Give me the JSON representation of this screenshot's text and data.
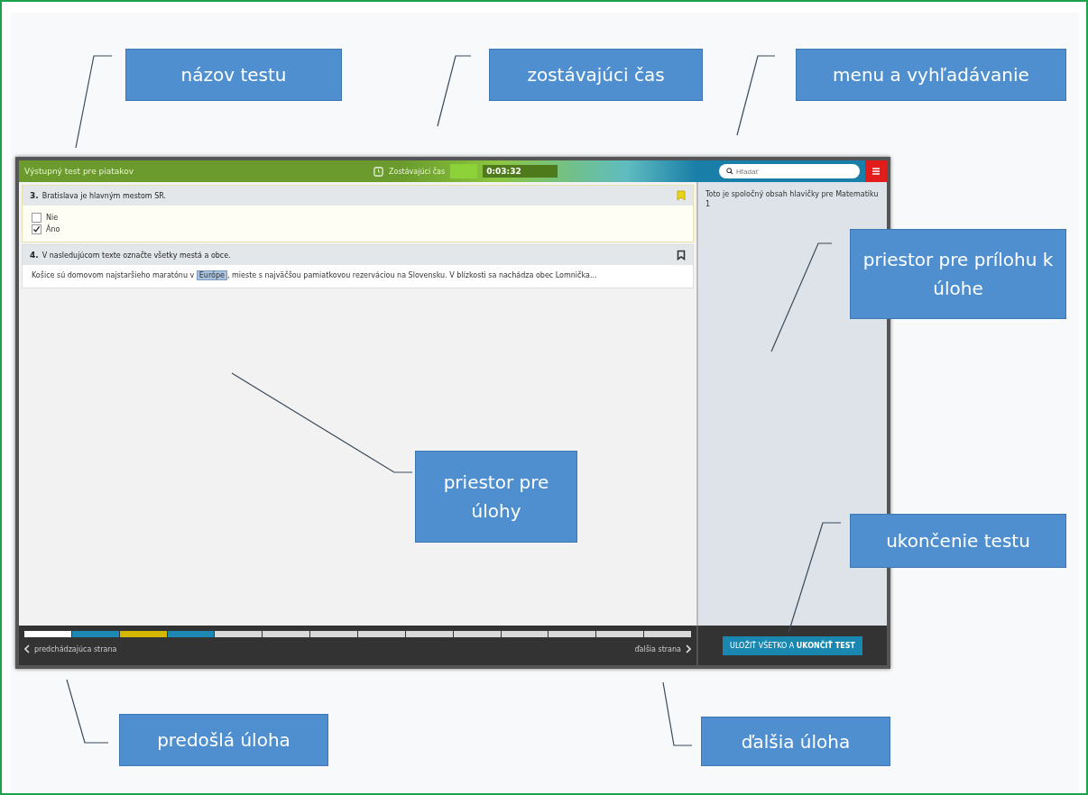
{
  "app": {
    "test_title": "Výstupný test pre piatakov",
    "timer": {
      "label": "Zostávajúci čas",
      "value": "0:03:32"
    },
    "search": {
      "placeholder": "Hľadať"
    },
    "questions": [
      {
        "number": "3.",
        "text": "Bratislava je hlavným mestom SR.",
        "bookmarked": true,
        "kind": "choice",
        "options": [
          {
            "label": "Nie",
            "checked": false
          },
          {
            "label": "Áno",
            "checked": true
          }
        ]
      },
      {
        "number": "4.",
        "text": "V nasledujúcom texte označte všetky mestá a obce.",
        "bookmarked": false,
        "kind": "passage",
        "passage_before": "Košice sú domovom najstaršieho maratónu v ",
        "highlight": "Európe",
        "passage_after": ", mieste s najväčšou pamiatkovou rezerváciou na Slovensku. V blízkosti sa nachádza obec Lomnička..."
      }
    ],
    "side_panel": {
      "text": "Toto je spoločný obsah hlavičky pre Matematiku 1"
    },
    "progress": [
      {
        "color": "#ffffff"
      },
      {
        "color": "#1e88b4"
      },
      {
        "color": "#d4b800"
      },
      {
        "color": "#1e88b4"
      },
      {
        "color": "#d9d9d9"
      },
      {
        "color": "#d9d9d9"
      },
      {
        "color": "#d9d9d9"
      },
      {
        "color": "#d9d9d9"
      },
      {
        "color": "#d9d9d9"
      },
      {
        "color": "#d9d9d9"
      },
      {
        "color": "#d9d9d9"
      },
      {
        "color": "#d9d9d9"
      },
      {
        "color": "#d9d9d9"
      },
      {
        "color": "#d9d9d9"
      }
    ],
    "prev_label": "predchádzajúca strana",
    "next_label": "ďalšia strana",
    "finish_button": "ULOŽIŤ VŠETKO A **UKONČIŤ TEST**"
  },
  "callouts": [
    {
      "text": "názov testu"
    },
    {
      "text": "zostávajúci čas"
    },
    {
      "text": "menu a vyhľadávanie"
    },
    {
      "text": "priestor pre prílohu k úlohe"
    },
    {
      "text": "priestor pre úlohy"
    },
    {
      "text": "ukončenie testu"
    },
    {
      "text": "predošlá úloha"
    },
    {
      "text": "ďalšia úloha"
    }
  ]
}
